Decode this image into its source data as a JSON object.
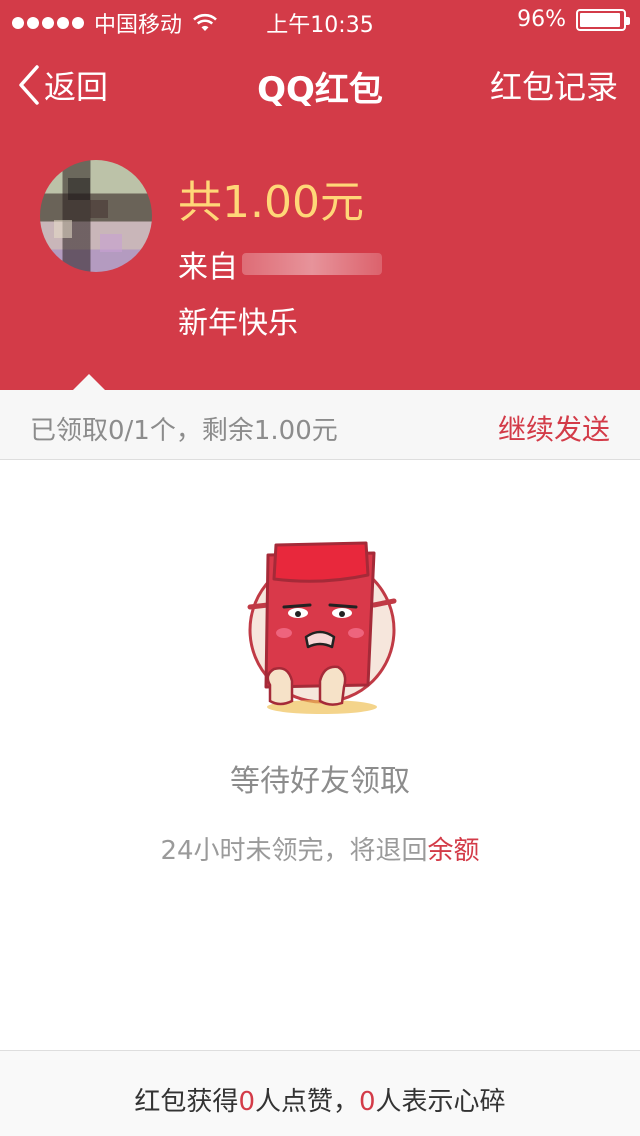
{
  "status_bar": {
    "carrier": "中国移动",
    "time": "上午10:35",
    "battery": "96%",
    "battery_level": 0.96
  },
  "nav": {
    "back_label": "返回",
    "title": "QQ红包",
    "records_label": "红包记录"
  },
  "packet": {
    "amount": "共1.00元",
    "from_prefix": "来自",
    "greeting": "新年快乐"
  },
  "info_bar": {
    "status_text": "已领取0/1个，剩余1.00元",
    "resend_label": "继续发送"
  },
  "waiting": {
    "title": "等待好友领取",
    "tip_prefix": "24小时未领完，将退回",
    "tip_highlight": "余额"
  },
  "footer": {
    "text_1": "红包获得",
    "likes_count": "0",
    "text_2": "人点赞，",
    "heartbreak_count": "0",
    "text_3": "人表示心碎"
  },
  "colors": {
    "header_red": "#d33b48",
    "amount_gold": "#ffd778",
    "accent_red": "#d33b48"
  },
  "icons": [
    "wifi-icon",
    "battery-icon",
    "back-chevron-icon",
    "red-packet-mascot-icon",
    "avatar"
  ]
}
